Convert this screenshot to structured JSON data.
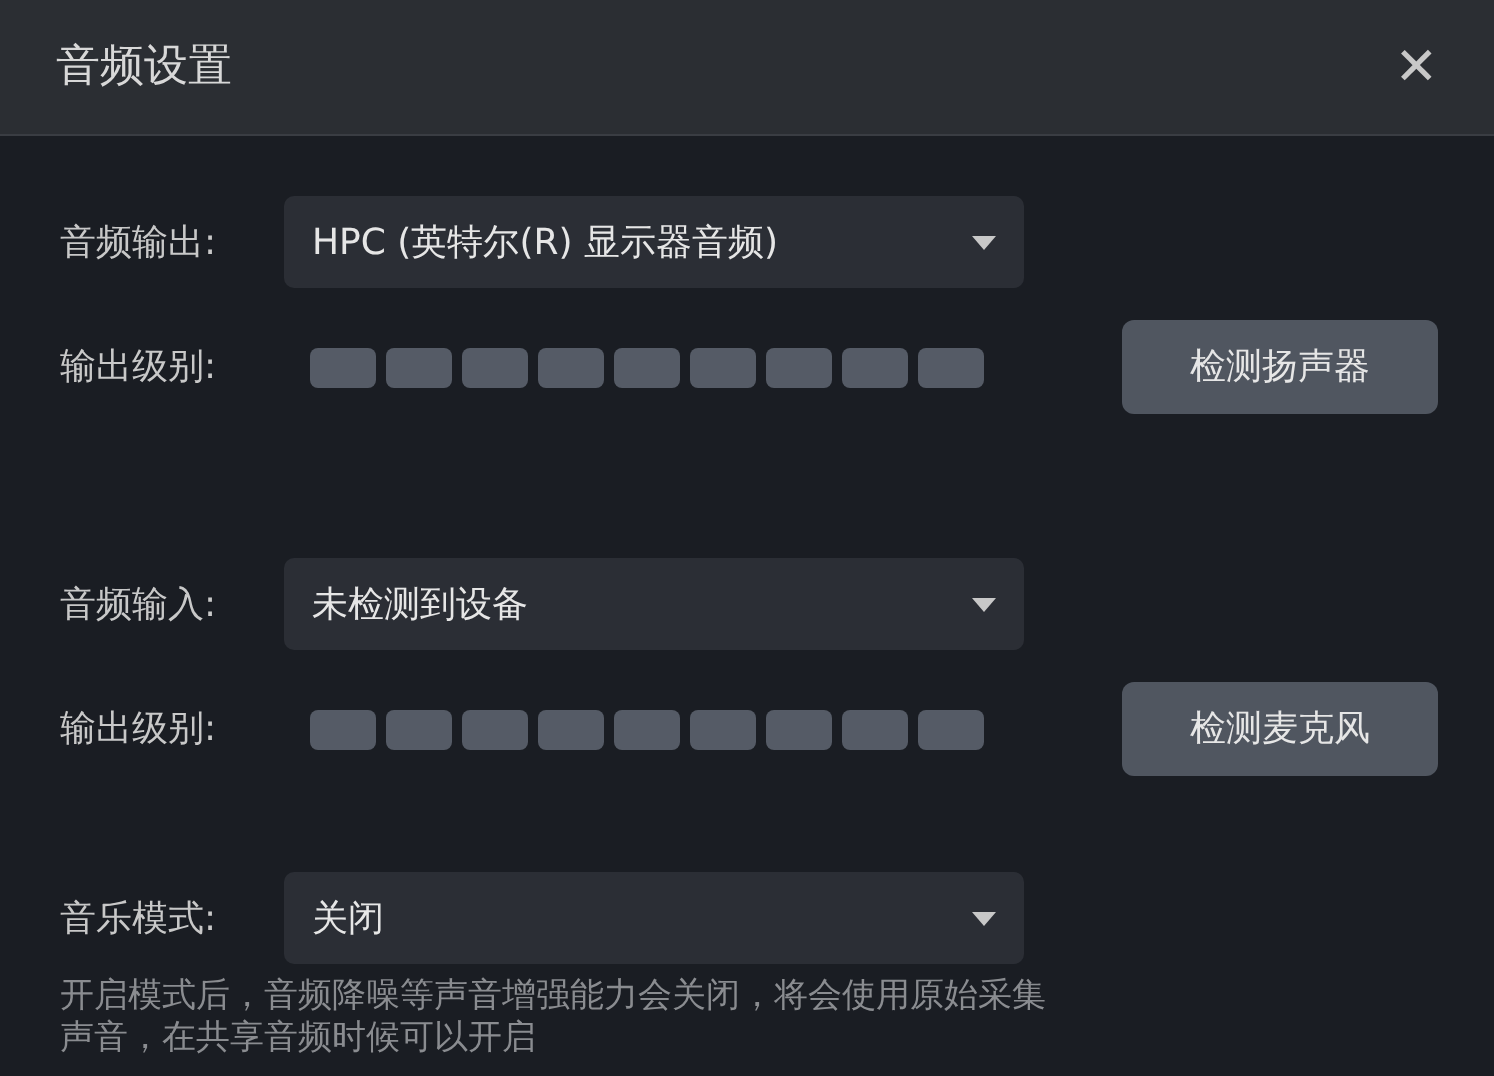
{
  "window": {
    "title": "音频设置",
    "close": "✕"
  },
  "devices": [
    {
      "label": "音频输出:",
      "value": "HPC (英特尔(R) 显示器音频)",
      "meter_label": "输出级别:",
      "button": "检测扬声器"
    },
    {
      "label": "音频输入:",
      "value": "未检测到设备",
      "meter_label": "输出级别:",
      "button": "检测麦克风"
    }
  ],
  "music_mode": {
    "label": "音乐模式:",
    "value": "关闭",
    "note": "开启模式后，音频降噪等声音增强能力会关闭，将会使用原始采集声音，在共享音频时候可以开启"
  }
}
